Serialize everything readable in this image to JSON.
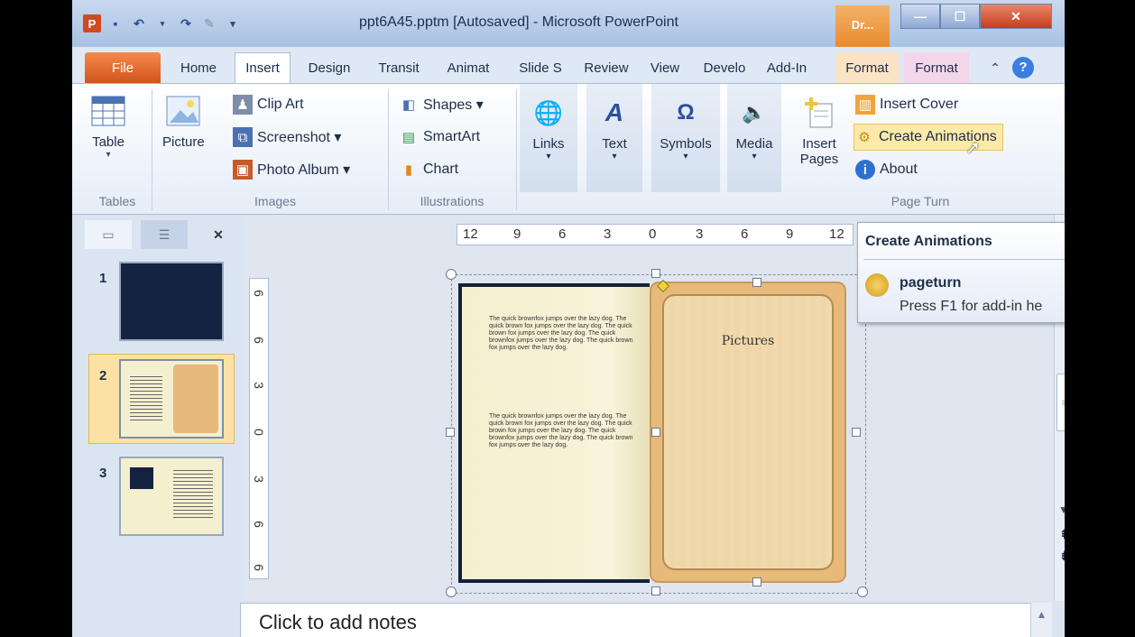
{
  "window": {
    "title": "ppt6A45.pptm [Autosaved] - Microsoft PowerPoint",
    "context_tab": "Dr..."
  },
  "qat": {
    "logo": "P"
  },
  "tabs": [
    "File",
    "Home",
    "Insert",
    "Design",
    "Transit",
    "Animat",
    "Slide S",
    "Review",
    "View",
    "Develo",
    "Add-In",
    "Format",
    "Format"
  ],
  "ribbon": {
    "tables": {
      "table_label": "Table",
      "group": "Tables"
    },
    "images": {
      "picture": "Picture",
      "clip_art": "Clip Art",
      "screenshot": "Screenshot ▾",
      "photo_album": "Photo Album ▾",
      "group": "Images"
    },
    "illustrations": {
      "shapes": "Shapes ▾",
      "smartart": "SmartArt",
      "chart": "Chart",
      "group": "Illustrations"
    },
    "links": "Links",
    "text": "Text",
    "symbols": "Symbols",
    "media": "Media",
    "page_turn": {
      "insert_pages_1": "Insert",
      "insert_pages_2": "Pages",
      "insert_cover": "Insert Cover",
      "create_animations": "Create Animations",
      "about": "About",
      "group": "Page Turn"
    }
  },
  "slides": [
    "1",
    "2",
    "3"
  ],
  "ruler_h": [
    "12",
    "9",
    "6",
    "3",
    "0",
    "3",
    "6",
    "9",
    "12"
  ],
  "ruler_v": [
    "6",
    "6",
    "3",
    "0",
    "3",
    "6",
    "6"
  ],
  "book": {
    "right_page_title": "Pictures",
    "para1": "The quick brownfox jumps over the lazy dog. The quick brown fox jumps over the lazy dog. The quick brown fox jumps over the lazy dog. The quick brownfox jumps over the lazy dog. The quick brown fox jumps over the lazy dog.",
    "para2": "The quick brownfox jumps over the lazy dog. The quick brown fox jumps over the lazy dog. The quick brown fox jumps over the lazy dog. The quick brownfox jumps over the lazy dog. The quick brown fox jumps over the lazy dog."
  },
  "tooltip": {
    "title": "Create Animations",
    "name": "pageturn",
    "desc": "Press F1 for add-in he"
  },
  "notes": {
    "placeholder": "Click to add notes"
  }
}
